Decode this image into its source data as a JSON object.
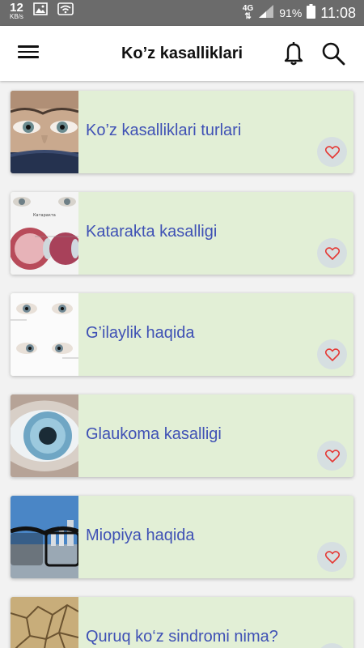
{
  "status_bar": {
    "speed_value": "12",
    "speed_unit": "KB/s",
    "network": "4G",
    "battery_percent": "91%",
    "time": "11:08"
  },
  "app_bar": {
    "title": "Ko’z kasalliklari",
    "menu_icon": "hamburger-menu-icon",
    "bell_icon": "bell-icon",
    "search_icon": "search-icon"
  },
  "colors": {
    "card_background": "#e2efd6",
    "title_text": "#3f51b5",
    "heart": "#e53935",
    "fav_circle": "#d6dfe1",
    "status_bar": "#6b6b6b"
  },
  "items": [
    {
      "title": "Ko’z kasalliklari turlari",
      "thumb": "eyes-closeup-image",
      "fav_icon": "heart-outline-icon"
    },
    {
      "title": "Katarakta kasalligi",
      "thumb": "cataract-diagram-image",
      "fav_icon": "heart-outline-icon"
    },
    {
      "title": "G’ilaylik haqida",
      "thumb": "strabismus-eyes-image",
      "fav_icon": "heart-outline-icon"
    },
    {
      "title": "Glaukoma kasalligi",
      "thumb": "iris-closeup-image",
      "fav_icon": "heart-outline-icon"
    },
    {
      "title": "Miopiya haqida",
      "thumb": "glasses-city-image",
      "fav_icon": "heart-outline-icon"
    },
    {
      "title": "Quruq ko‘z sindromi nima?",
      "thumb": "cracked-earth-image",
      "fav_icon": "heart-outline-icon"
    }
  ]
}
